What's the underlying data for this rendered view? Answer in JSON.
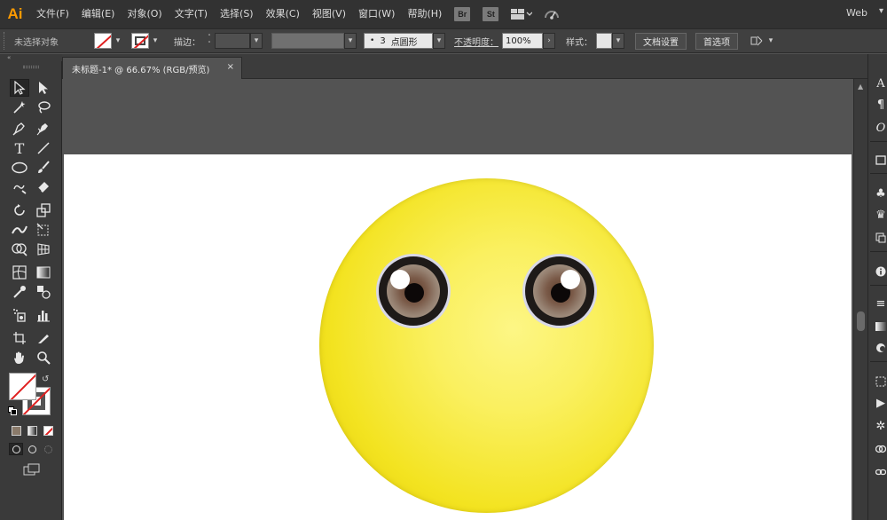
{
  "app": {
    "logo": "Ai",
    "menu": [
      "文件(F)",
      "编辑(E)",
      "对象(O)",
      "文字(T)",
      "选择(S)",
      "效果(C)",
      "视图(V)",
      "窗口(W)",
      "帮助(H)"
    ],
    "bridge_badge": "Br",
    "stock_badge": "St",
    "workspace": "Web",
    "icons": [
      "arrange-documents-icon",
      "gpu-performance-icon"
    ]
  },
  "control_bar": {
    "selection_label": "未选择对象",
    "stroke_label": "描边：",
    "brush_dot": "•",
    "brush_size": "3",
    "brush_shape": "点圆形",
    "opacity_label": "不透明度：",
    "opacity_value": "100%",
    "style_label": "样式：",
    "doc_setup_button": "文档设置",
    "preferences_button": "首选项"
  },
  "document": {
    "tab_title": "未标题-1* @ 66.67% (RGB/预览)",
    "tab_close": "×"
  },
  "colors": {
    "emoji_face": "#f3e320",
    "iris": "#8a6e5e",
    "pupil": "#0c0808",
    "fill_none_slash": "#e02020",
    "logo": "#ff9a00"
  },
  "tools": [
    "selection-tool",
    "direct-selection-tool",
    "magic-wand-tool",
    "lasso-tool",
    "pen-tool",
    "curvature-tool",
    "type-tool",
    "line-segment-tool",
    "ellipse-tool",
    "paintbrush-tool",
    "shaper-tool",
    "eraser-tool",
    "rotate-tool",
    "scale-tool",
    "width-tool",
    "free-transform-tool",
    "shape-builder-tool",
    "perspective-grid-tool",
    "mesh-tool",
    "gradient-tool",
    "eyedropper-tool",
    "blend-tool",
    "symbol-sprayer-tool",
    "column-graph-tool",
    "artboard-tool",
    "slice-tool",
    "hand-tool",
    "zoom-tool"
  ],
  "right_panels": [
    "character-panel",
    "paragraph-panel",
    "opentype-panel",
    "transform-panel",
    "symbols-panel",
    "libraries-panel",
    "links-panel",
    "info-panel",
    "stroke-panel",
    "gradient-panel",
    "color-guide-panel",
    "align-panel",
    "actions-panel",
    "appearance-panel",
    "graphic-styles-panel"
  ]
}
